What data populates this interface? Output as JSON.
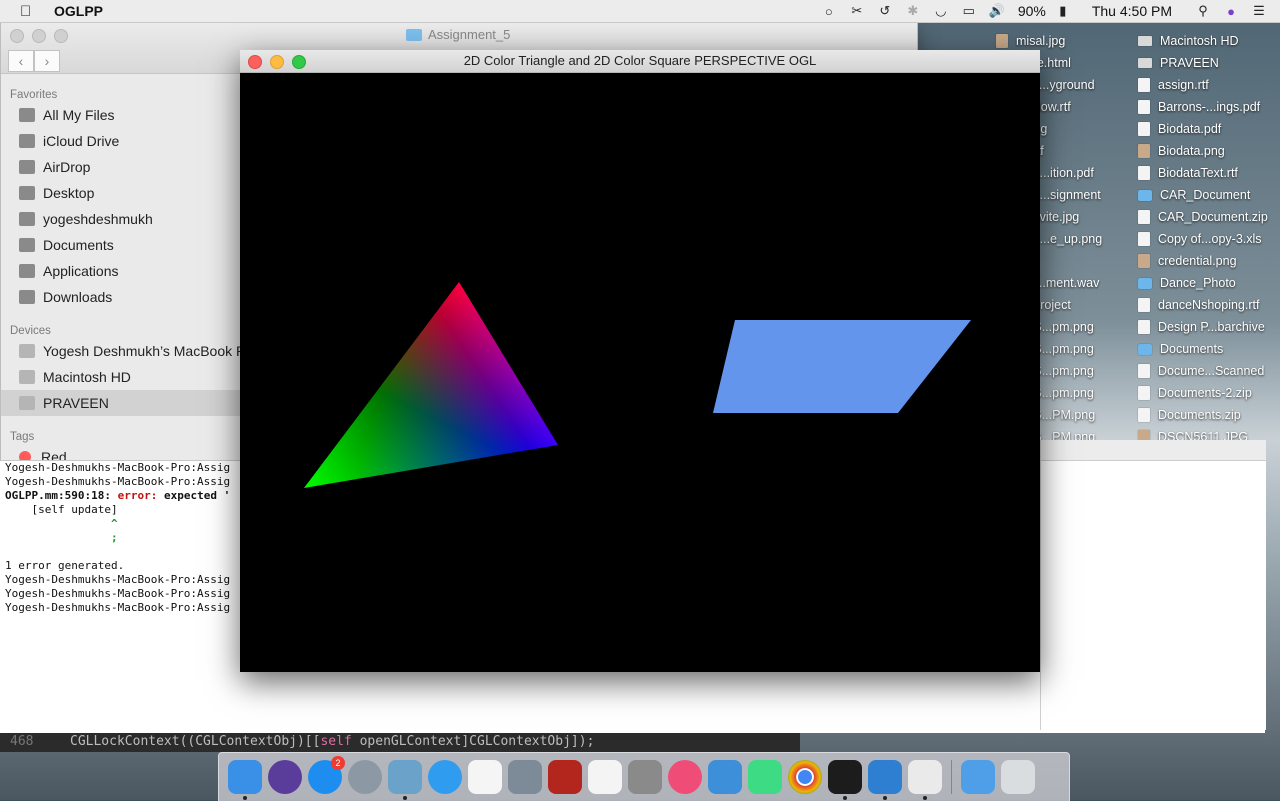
{
  "menubar": {
    "app_name": "OGLPP",
    "battery_percent": "90%",
    "clock": "Thu 4:50 PM",
    "icons": [
      "apple-icon",
      "airplay-audio-icon",
      "scissors-icon",
      "time-machine-icon",
      "bluetooth-icon",
      "wifi-icon",
      "airplay-icon",
      "volume-icon",
      "battery-icon",
      "spotlight-icon",
      "siri-icon",
      "notification-center-icon"
    ]
  },
  "finder": {
    "title": "Assignment_5",
    "favorites_header": "Favorites",
    "favorites": [
      "All My Files",
      "iCloud Drive",
      "AirDrop",
      "Desktop",
      "yogeshdeshmukh",
      "Documents",
      "Applications",
      "Downloads"
    ],
    "devices_header": "Devices",
    "devices": [
      "Yogesh Deshmukh’s MacBook Pr",
      "Macintosh HD",
      "PRAVEEN"
    ],
    "tags_header": "Tags",
    "tags": [
      "Red"
    ]
  },
  "gl_window": {
    "title": "2D Color Triangle and 2D Color Square PERSPECTIVE OGL",
    "triangle_colors": [
      "#ff0000",
      "#00ff00",
      "#0000ff"
    ],
    "square_color": "#6495ed"
  },
  "terminal": {
    "lines": [
      "Yogesh-Deshmukhs-MacBook-Pro:Assig",
      "Yogesh-Deshmukhs-MacBook-Pro:Assig",
      "",
      "    [self update]",
      "",
      "",
      "",
      "1 error generated.",
      "Yogesh-Deshmukhs-MacBook-Pro:Assig",
      "Yogesh-Deshmukhs-MacBook-Pro:Assig",
      "Yogesh-Deshmukhs-MacBook-Pro:Assig"
    ],
    "error_location": "OGLPP.mm:590:18:",
    "error_label": "error:",
    "error_text": "expected '",
    "caret": "^",
    "fix_hint": ";"
  },
  "code_strip": {
    "line_number": "468",
    "code_prefix": "CGLLockContext((CGLContextObj)[[",
    "code_keyword": "self",
    "code_suffix": " openGLContext]CGLContextObj]);"
  },
  "desktop": {
    "right_column": [
      "Macintosh HD",
      "PRAVEEN",
      "assign.rtf",
      "Barrons-...ings.pdf",
      "Biodata.pdf",
      "Biodata.png",
      "BiodataText.rtf",
      "CAR_Document",
      "CAR_Document.zip",
      "Copy of...opy-3.xls",
      "credential.png",
      "Dance_Photo",
      "danceNshoping.rtf",
      "Design P...barchive",
      "Documents",
      "Docume...Scanned",
      "Documents-2.zip",
      "Documents.zip",
      "DSCN5611.JPG"
    ],
    "left_column": [
      "misal.jpg",
      "nage.html",
      "layg...yground",
      "Vindow.rtf",
      "n.png",
      "ce.rtf",
      "nGL...ition.pdf",
      "nGL...signment",
      "o_invite.jpg",
      "o_in...e_up.png",
      "jpg",
      "ess...ment.wav",
      "peProject",
      "en S...pm.png",
      "en S...pm.png",
      "en S...pm.png",
      "en S...pm.png",
      "en S...PM.png",
      "en S...PM.png"
    ]
  },
  "dock": {
    "apps": [
      "finder-icon",
      "siri-icon",
      "app-store-icon",
      "launchpad-icon",
      "preview-icon",
      "safari-icon",
      "calendar-grid-icon",
      "image-capture-icon",
      "photo-booth-icon",
      "photos-icon",
      "system-preferences-icon",
      "itunes-icon",
      "xcode-icon",
      "android-studio-icon",
      "chrome-icon",
      "terminal-icon",
      "xcode-build-icon",
      "text-edit-icon",
      "downloads-stack-icon",
      "trash-icon"
    ],
    "app_store_badge": "2"
  }
}
